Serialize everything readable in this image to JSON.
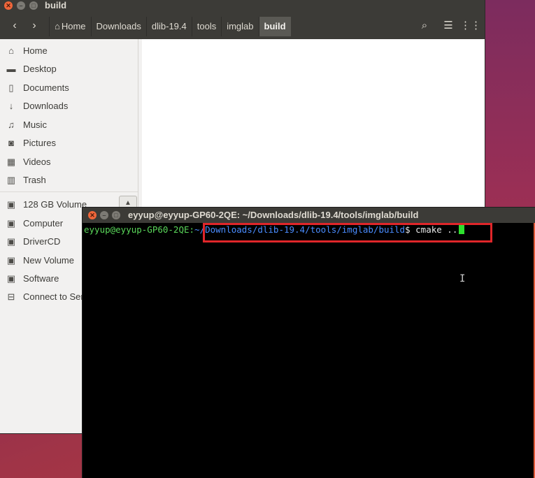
{
  "nautilus": {
    "title": "build",
    "breadcrumbs": [
      "Home",
      "Downloads",
      "dlib-19.4",
      "tools",
      "imglab",
      "build"
    ],
    "active_crumb": "build",
    "sidebar": {
      "places": [
        {
          "label": "Home",
          "icon": "home-icon"
        },
        {
          "label": "Desktop",
          "icon": "folder-icon"
        },
        {
          "label": "Documents",
          "icon": "document-icon"
        },
        {
          "label": "Downloads",
          "icon": "download-icon"
        },
        {
          "label": "Music",
          "icon": "music-icon"
        },
        {
          "label": "Pictures",
          "icon": "camera-icon"
        },
        {
          "label": "Videos",
          "icon": "video-icon"
        },
        {
          "label": "Trash",
          "icon": "trash-icon"
        }
      ],
      "devices": [
        {
          "label": "128 GB Volume",
          "icon": "drive-icon"
        },
        {
          "label": "Computer",
          "icon": "drive-icon"
        },
        {
          "label": "DriverCD",
          "icon": "drive-icon"
        },
        {
          "label": "New Volume",
          "icon": "drive-icon"
        },
        {
          "label": "Software",
          "icon": "drive-icon"
        },
        {
          "label": "Connect to Ser",
          "icon": "network-icon"
        }
      ]
    }
  },
  "terminal": {
    "title": "eyyup@eyyup-GP60-2QE: ~/Downloads/dlib-19.4/tools/imglab/build",
    "prompt_user": "eyyup@eyyup-GP60-2QE:",
    "prompt_path": "~/Downloads/dlib-19.4/tools/imglab/build",
    "prompt_symbol": "$",
    "command": "cmake .."
  },
  "colors": {
    "highlight": "#e0262a",
    "terminal_prompt": "#4ee04e",
    "terminal_path": "#4a8cff",
    "titlebar": "#3c3b37"
  }
}
